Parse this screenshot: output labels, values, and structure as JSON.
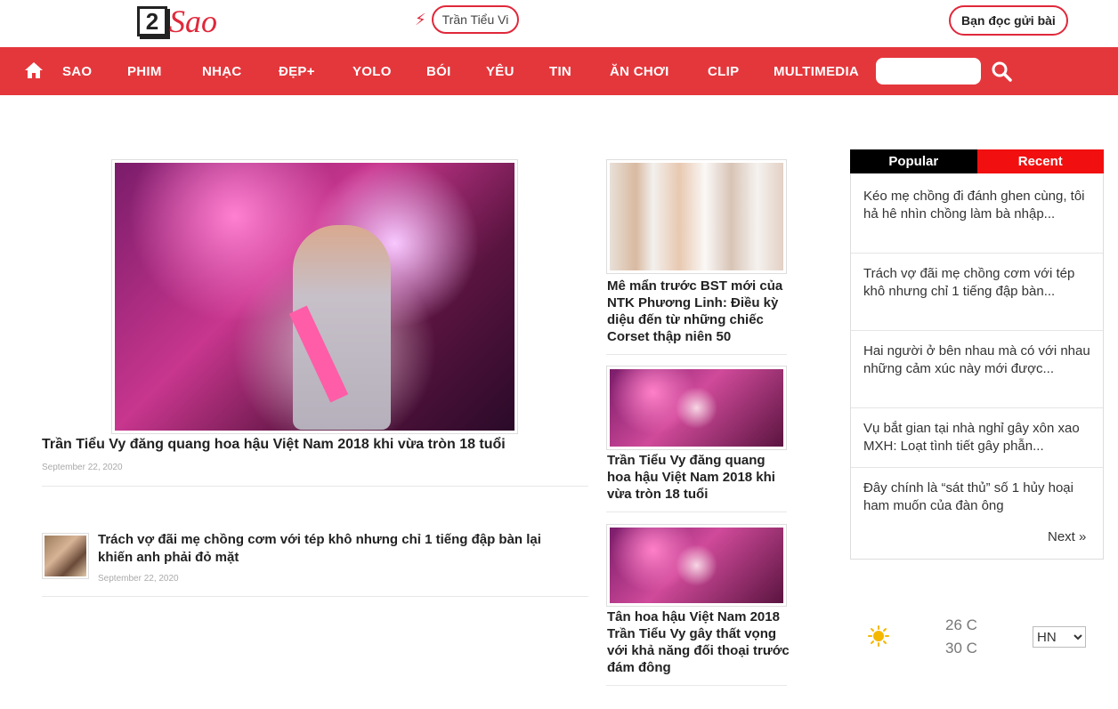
{
  "header": {
    "logo_number": "2",
    "logo_text": "Sao",
    "hot_tag": "Trần Tiểu Vi",
    "reader_button": "Bạn đọc gửi bài"
  },
  "nav": {
    "items": [
      "SAO",
      "PHIM",
      "NHẠC",
      "ĐẸP+",
      "YOLO",
      "BÓI",
      "YÊU",
      "TIN",
      "ĂN CHƠI",
      "CLIP",
      "MULTIMEDIA"
    ],
    "search_placeholder": ""
  },
  "feature": {
    "title": "Trần Tiểu Vy đăng quang hoa hậu Việt Nam 2018 khi vừa tròn 18 tuổi",
    "date": "September 22, 2020"
  },
  "secondary": {
    "title": "Trách vợ đãi mẹ chồng cơm với tép khô nhưng chỉ 1 tiếng đập bàn lại khiến anh phải đỏ mặt",
    "date": "September 22, 2020"
  },
  "middle": {
    "items": [
      {
        "title": "Mê mẩn trước BST mới của NTK Phương Linh: Điều kỳ diệu đến từ những chiếc Corset thập niên 50"
      },
      {
        "title": "Trần Tiểu Vy đăng quang hoa hậu Việt Nam 2018 khi vừa tròn 18 tuổi"
      },
      {
        "title": "Tân hoa hậu Việt Nam 2018 Trần Tiểu Vy gây thất vọng với khả năng đối thoại trước đám đông"
      }
    ]
  },
  "sidebar": {
    "tab_popular": "Popular",
    "tab_recent": "Recent",
    "items": [
      "Kéo mẹ chồng đi đánh ghen cùng, tôi hả hê nhìn chồng làm bà nhập...",
      "Trách vợ đãi mẹ chồng cơm với tép khô nhưng chỉ 1 tiếng đập bàn...",
      "Hai người ở bên nhau mà có với nhau những cảm xúc này mới được...",
      "Vụ bắt gian tại nhà nghỉ gây xôn xao MXH: Loạt tình tiết gây phẫn...",
      "Đây chính là “sát thủ” số 1 hủy hoại ham muốn của đàn ông"
    ],
    "next_label": "Next »"
  },
  "weather": {
    "temp_low": "26 C",
    "temp_high": "30 C",
    "city": "HN",
    "icon": "sun-icon",
    "colors": {
      "sun": "#f5b800"
    }
  },
  "colors": {
    "brand_red": "#e4373c",
    "recent_tab": "#f20f0f",
    "popular_tab": "#000000"
  }
}
